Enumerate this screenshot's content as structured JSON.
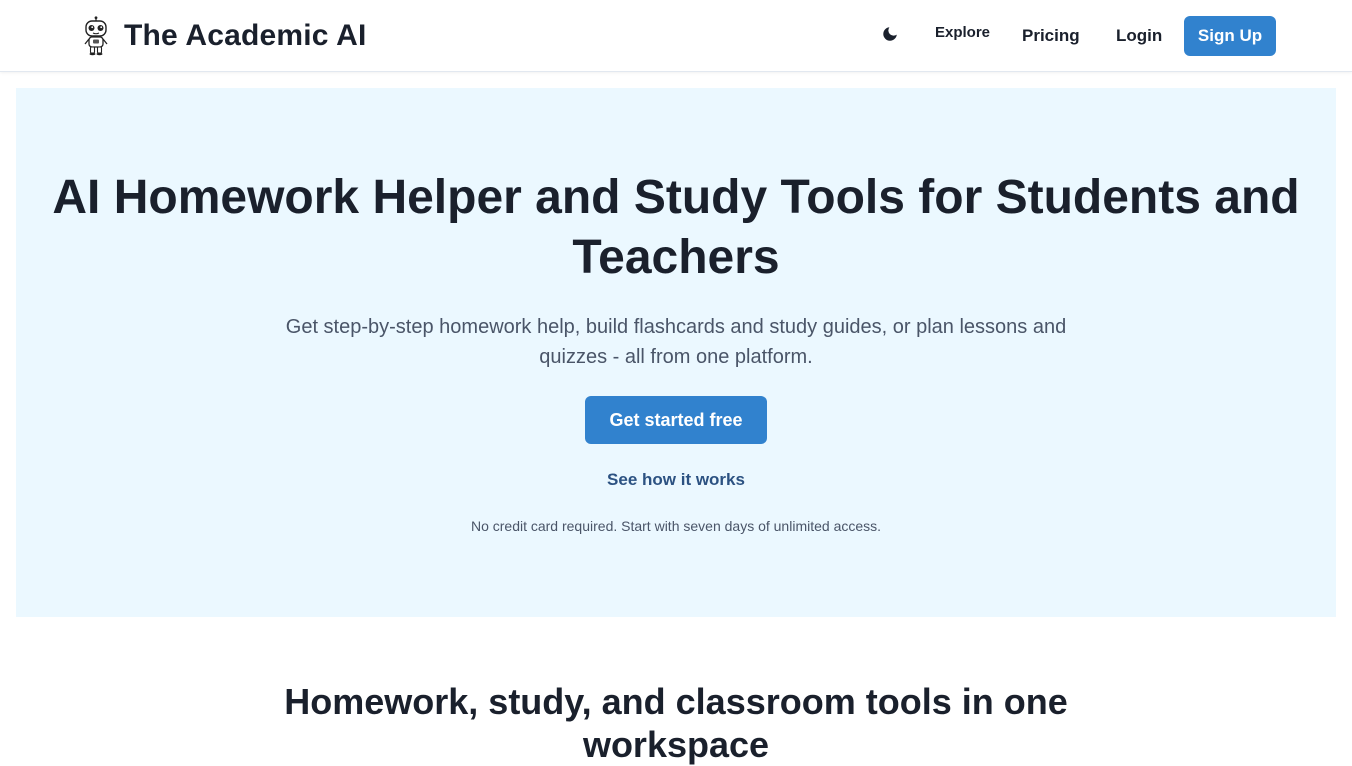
{
  "navbar": {
    "brand_name": "The Academic AI",
    "logo_icon": "robot-mascot-icon",
    "theme_toggle_icon": "moon-icon",
    "links": {
      "explore": "Explore",
      "pricing": "Pricing",
      "login": "Login"
    },
    "signup_label": "Sign Up"
  },
  "hero": {
    "title": "AI Homework Helper and Study Tools for Students and Teachers",
    "subtitle": "Get step-by-step homework help, build flashcards and study guides, or plan lessons and quizzes - all from one platform.",
    "cta_label": "Get started free",
    "secondary_link": "See how it works",
    "note": "No credit card required. Start with seven days of unlimited access."
  },
  "features": {
    "title": "Homework, study, and classroom tools in one workspace"
  },
  "colors": {
    "accent": "#3182ce",
    "hero_background": "#ebf8ff",
    "heading_text": "#1a202c",
    "body_text": "#4a5568",
    "link_text": "#2c5282"
  }
}
